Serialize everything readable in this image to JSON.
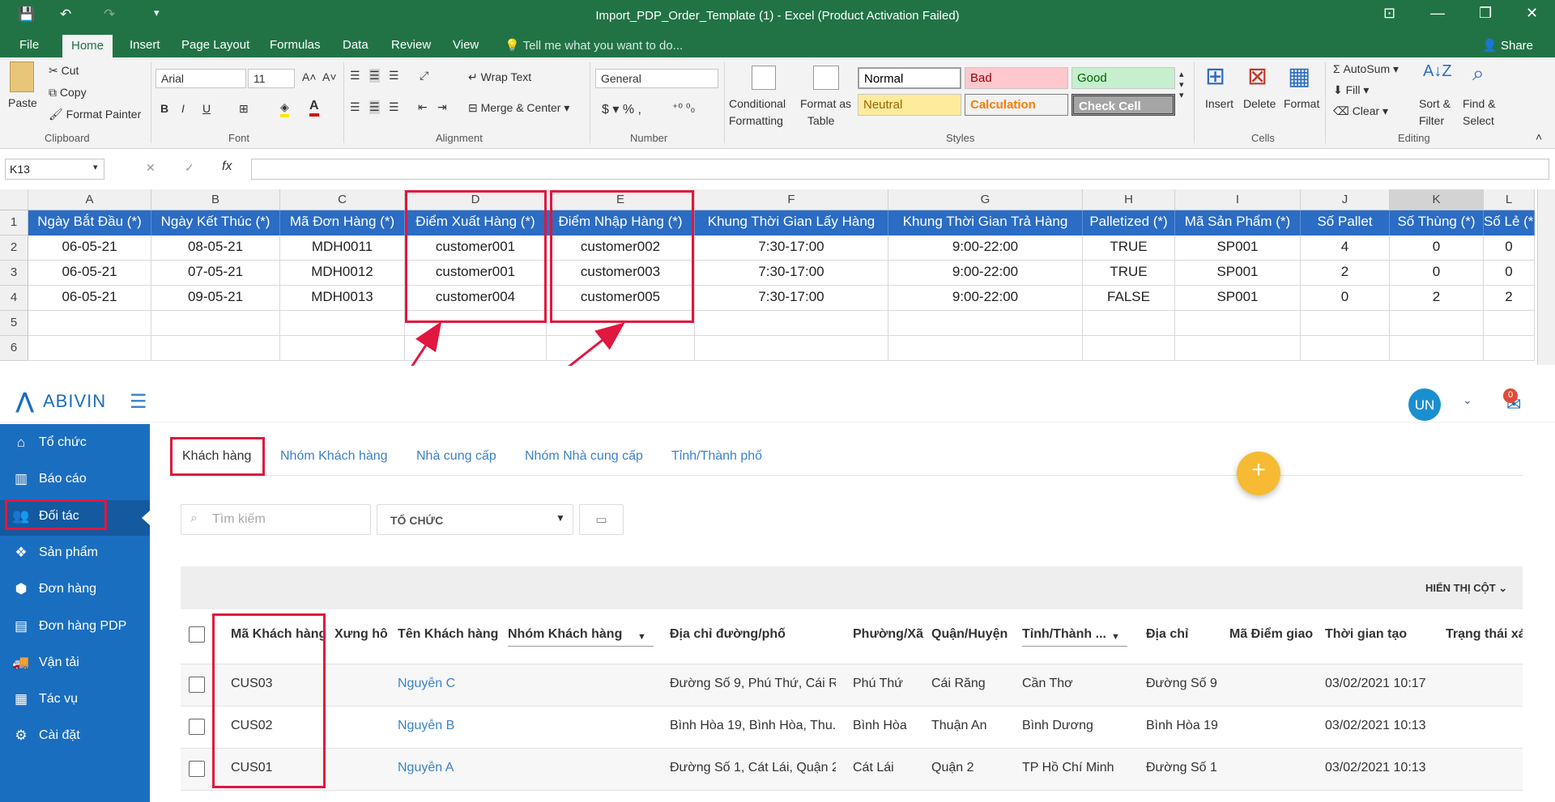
{
  "excel": {
    "title": "Import_PDP_Order_Template (1) - Excel (Product Activation Failed)",
    "tabs": [
      "File",
      "Home",
      "Insert",
      "Page Layout",
      "Formulas",
      "Data",
      "Review",
      "View"
    ],
    "tell_me": "Tell me what you want to do...",
    "share": "Share",
    "clipboard": {
      "paste": "Paste",
      "cut": "Cut",
      "copy": "Copy",
      "format_painter": "Format Painter",
      "group": "Clipboard"
    },
    "font": {
      "name": "Arial",
      "size": "11",
      "group": "Font"
    },
    "alignment": {
      "wrap": "Wrap Text",
      "merge": "Merge & Center",
      "group": "Alignment"
    },
    "number": {
      "format": "General",
      "group": "Number"
    },
    "styles": {
      "conditional": "Conditional",
      "conditional2": "Formatting",
      "format_as": "Format as",
      "format_as2": "Table",
      "normal": "Normal",
      "bad": "Bad",
      "good": "Good",
      "neutral": "Neutral",
      "calculation": "Calculation",
      "check_cell": "Check Cell",
      "group": "Styles"
    },
    "cells": {
      "insert": "Insert",
      "delete": "Delete",
      "format": "Format",
      "group": "Cells"
    },
    "editing": {
      "autosum": "AutoSum",
      "fill": "Fill",
      "clear": "Clear",
      "sort": "Sort &",
      "sort2": "Filter",
      "find": "Find &",
      "find2": "Select",
      "group": "Editing"
    },
    "name_box": "K13",
    "columns": [
      "A",
      "B",
      "C",
      "D",
      "E",
      "F",
      "G",
      "H",
      "I",
      "J",
      "K",
      "L"
    ],
    "rows": [
      "1",
      "2",
      "3",
      "4",
      "5",
      "6"
    ],
    "headers": [
      "Ngày Bắt Đầu (*)",
      "Ngày Kết Thúc (*)",
      "Mã Đơn Hàng (*)",
      "Điểm Xuất Hàng (*)",
      "Điểm Nhập Hàng  (*)",
      "Khung Thời Gian Lấy Hàng",
      "Khung Thời Gian Trả Hàng",
      "Palletized (*)",
      "Mã Sản Phẩm (*)",
      "Số Pallet",
      "Số Thùng (*)",
      "Số Lẻ (*)"
    ],
    "data": [
      [
        "06-05-21",
        "08-05-21",
        "MDH0011",
        "customer001",
        "customer002",
        "7:30-17:00",
        "9:00-22:00",
        "TRUE",
        "SP001",
        "4",
        "0",
        "0"
      ],
      [
        "06-05-21",
        "07-05-21",
        "MDH0012",
        "customer001",
        "customer003",
        "7:30-17:00",
        "9:00-22:00",
        "TRUE",
        "SP001",
        "2",
        "0",
        "0"
      ],
      [
        "06-05-21",
        "09-05-21",
        "MDH0013",
        "customer004",
        "customer005",
        "7:30-17:00",
        "9:00-22:00",
        "FALSE",
        "SP001",
        "0",
        "2",
        "2"
      ]
    ]
  },
  "abivin": {
    "brand": "ABIVIN",
    "avatar": "UN",
    "notification_count": "0",
    "sidebar": [
      {
        "label": "Tổ chức",
        "icon": "home-icon"
      },
      {
        "label": "Báo cáo",
        "icon": "chart-icon"
      },
      {
        "label": "Đối tác",
        "icon": "users-icon"
      },
      {
        "label": "Sản phẩm",
        "icon": "dropbox-icon"
      },
      {
        "label": "Đơn hàng",
        "icon": "cubes-icon"
      },
      {
        "label": "Đơn hàng PDP",
        "icon": "list-icon"
      },
      {
        "label": "Vận tải",
        "icon": "truck-icon"
      },
      {
        "label": "Tác vụ",
        "icon": "calendar-icon"
      },
      {
        "label": "Cài đặt",
        "icon": "gear-icon"
      }
    ],
    "tabs": [
      "Khách hàng",
      "Nhóm Khách hàng",
      "Nhà cung cấp",
      "Nhóm Nhà cung cấp",
      "Tỉnh/Thành phố"
    ],
    "search_placeholder": "Tìm kiếm",
    "org_select": "TỔ CHỨC",
    "show_columns": "HIỂN THỊ CỘT",
    "table_headers": [
      "Mã Khách hàng",
      "Xưng hô",
      "Tên Khách hàng",
      "Nhóm Khách hàng",
      "Địa chỉ đường/phố",
      "Phường/Xã",
      "Quận/Huyện",
      "Tỉnh/Thành ...",
      "Địa chỉ",
      "Mã Điểm giao",
      "Thời gian tạo",
      "Trạng thái xác"
    ],
    "rows": [
      [
        "CUS03",
        "",
        "Nguyễn C",
        "",
        "Đường Số 9, Phú Thứ, Cái R...",
        "Phú Thứ",
        "Cái Răng",
        "Cần Thơ",
        "Đường Số 9",
        "",
        "03/02/2021 10:17",
        ""
      ],
      [
        "CUS02",
        "",
        "Nguyễn B",
        "",
        "Bình Hòa 19, Bình Hòa, Thu...",
        "Bình Hòa",
        "Thuận An",
        "Bình Dương",
        "Bình Hòa 19",
        "",
        "03/02/2021 10:13",
        ""
      ],
      [
        "CUS01",
        "",
        "Nguyễn A",
        "",
        "Đường Số 1, Cát Lái, Quận 2...",
        "Cát Lái",
        "Quận 2",
        "TP Hồ Chí Minh",
        "Đường Số 1",
        "",
        "03/02/2021 10:13",
        ""
      ]
    ],
    "colors": {
      "sidebar": "#1a6ec0",
      "accent": "#3a83c9",
      "fab": "#f6bb33",
      "annotation": "#e0173e"
    }
  }
}
